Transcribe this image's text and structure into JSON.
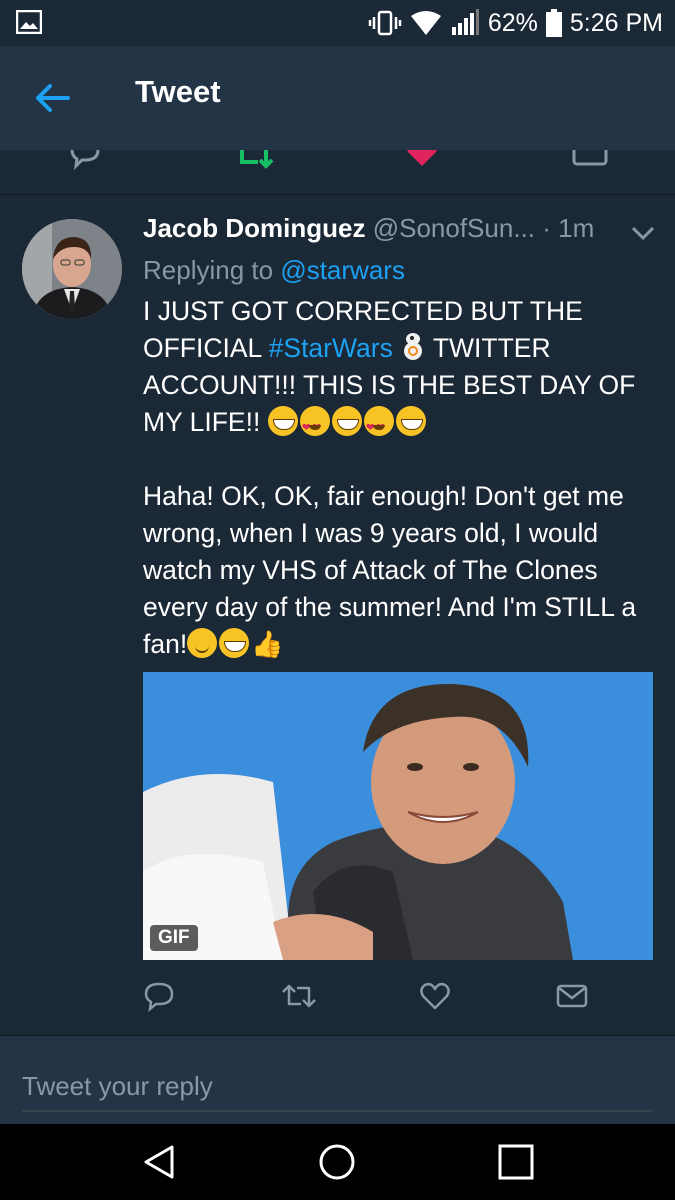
{
  "status_bar": {
    "battery": "62%",
    "time": "5:26 PM",
    "icons": [
      "gallery-icon",
      "vibrate-icon",
      "wifi-icon",
      "signal-icon",
      "battery-icon"
    ]
  },
  "app_bar": {
    "title": "Tweet",
    "back_icon": "arrow-left-icon"
  },
  "tweet": {
    "author_name": "Jacob Dominguez",
    "author_handle": "@SonofSun...",
    "time": "· 1m",
    "replying_prefix": "Replying to",
    "replying_to": "@starwars",
    "text_part1": "I JUST GOT CORRECTED BUT THE OFFICIAL",
    "hashtag": "#StarWars",
    "text_part2": "TWITTER ACCOUNT!!! THIS IS THE BEST DAY OF MY LIFE!!",
    "text_para2": "Haha! OK, OK, fair enough! Don't get me wrong, when I was 9 years old, I would watch my VHS of Attack of The Clones every day of the summer! And I'm STILL a fan!",
    "media_badge": "GIF"
  },
  "actions": [
    "reply-icon",
    "retweet-icon",
    "like-icon",
    "direct-message-icon"
  ],
  "reply_box": {
    "placeholder": "Tweet your reply"
  },
  "nav_bar": [
    "back-triangle-icon",
    "home-circle-icon",
    "recents-square-icon"
  ],
  "colors": {
    "background": "#1b2836",
    "app_bar": "#243447",
    "accent": "#1da1f2",
    "secondary_text": "#8899a6",
    "retweet_green": "#17bf63",
    "like_red": "#e0245e"
  }
}
